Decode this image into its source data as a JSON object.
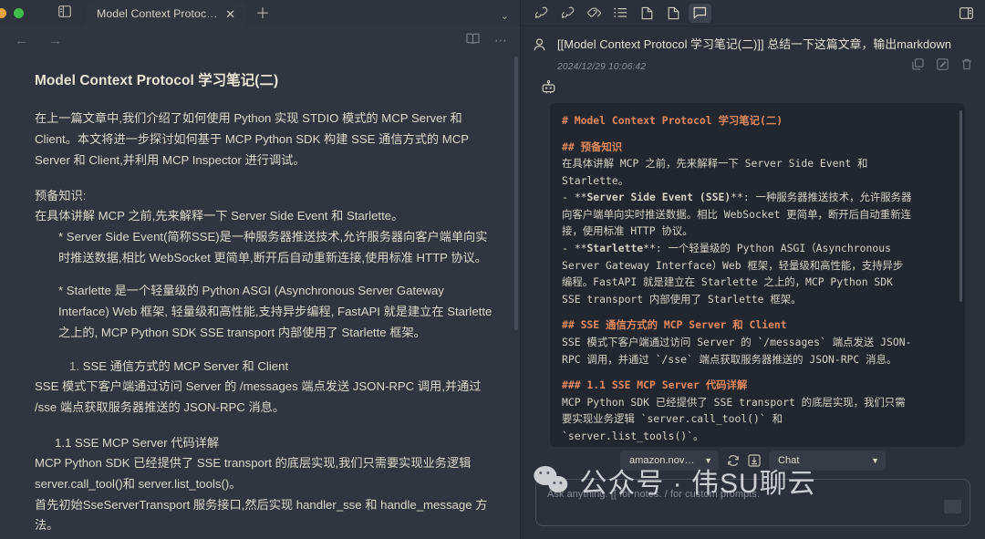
{
  "window": {
    "traffic_lights": [
      "minimize",
      "maximize"
    ],
    "sidebar_toggle_icon": "sidebar-icon",
    "tab": {
      "title": "Model Context Protocol ...",
      "close_icon": "close-icon"
    },
    "new_tab_icon": "plus-icon",
    "tab_overflow_icon": "chevron-down-icon"
  },
  "navbar": {
    "back_icon": "arrow-left-icon",
    "forward_icon": "arrow-right-icon",
    "reader_icon": "book-icon",
    "more_icon": "ellipsis-icon"
  },
  "document": {
    "title": "Model Context Protocol 学习笔记(二)",
    "paragraphs": [
      "在上一篇文章中,我们介绍了如何使用 Python 实现 STDIO 模式的 MCP Server 和 Client。本文将进一步探讨如何基于 MCP Python SDK 构建 SSE 通信方式的 MCP Server 和 Client,并利用 MCP Inspector 进行调试。"
    ],
    "prereq_label": "预备知识:",
    "prereq_intro": "在具体讲解 MCP 之前,先来解释一下 Server Side Event 和 Starlette。",
    "bullets": [
      "* Server Side Event(简称SSE)是一种服务器推送技术,允许服务器向客户端单向实时推送数据,相比 WebSocket 更简单,断开后自动重新连接,使用标准 HTTP 协议。",
      "* Starlette 是一个轻量级的 Python ASGI (Asynchronous Server Gateway Interface) Web 框架, 轻量级和高性能,支持异步编程, FastAPI 就是建立在 Starlette 之上的, MCP Python SDK SSE transport 内部使用了 Starlette 框架。"
    ],
    "section1_num": "1.",
    "section1_title": "SSE 通信方式的 MCP Server 和 Client",
    "section1_body": "SSE 模式下客户端通过访问 Server 的 /messages 端点发送 JSON-RPC 调用,并通过 /sse 端点获取服务器推送的 JSON-RPC 消息。",
    "section11_title": "1.1 SSE MCP Server 代码详解",
    "section11_body1": "MCP Python SDK 已经提供了 SSE transport 的底层实现,我们只需要实现业务逻辑server.call_tool()和 server.list_tools()。",
    "section11_body2": "首先初始SseServerTransport 服务接口,然后实现 handler_sse 和 handle_message 方法。"
  },
  "chat": {
    "toolbar_icons": [
      "link-add-icon",
      "link-add-alt-icon",
      "tags-icon",
      "list-icon",
      "document-icon",
      "document-alt-icon",
      "chat-bubble-icon"
    ],
    "panel_toggle_icon": "panel-right-icon",
    "user_avatar_icon": "user-icon",
    "message_title": "[[Model Context Protocol 学习笔记(二)]] 总结一下这篇文章，输出markdown",
    "timestamp": "2024/12/29 10:06:42",
    "message_actions": [
      "copy-icon",
      "edit-icon",
      "delete-icon"
    ],
    "bot_avatar_icon": "robot-icon",
    "response_lines": [
      {
        "prefix": "# ",
        "text": "Model Context Protocol 学习笔记(二)",
        "style": "heading"
      },
      {
        "prefix": "",
        "text": "",
        "style": "blank"
      },
      {
        "prefix": "## ",
        "text": "预备知识",
        "style": "heading"
      },
      {
        "prefix": "",
        "text": "在具体讲解 MCP 之前，先来解释一下 Server Side Event 和",
        "style": "body"
      },
      {
        "prefix": "",
        "text": "Starlette。",
        "style": "body"
      },
      {
        "prefix": "",
        "text": "- **Server Side Event (SSE)**: 一种服务器推送技术，允许服务器",
        "style": "body-bold-lead"
      },
      {
        "prefix": "",
        "text": "向客户端单向实时推送数据。相比 WebSocket 更简单，断开后自动重新连",
        "style": "body"
      },
      {
        "prefix": "",
        "text": "接，使用标准 HTTP 协议。",
        "style": "body"
      },
      {
        "prefix": "",
        "text": "- **Starlette**: 一个轻量级的 Python ASGI（Asynchronous",
        "style": "body-bold-lead2"
      },
      {
        "prefix": "",
        "text": "Server Gateway Interface）Web 框架，轻量级和高性能，支持异步",
        "style": "body"
      },
      {
        "prefix": "",
        "text": "编程。FastAPI 就是建立在 Starlette 之上的，MCP Python SDK",
        "style": "body"
      },
      {
        "prefix": "",
        "text": "SSE transport 内部使用了 Starlette 框架。",
        "style": "body"
      },
      {
        "prefix": "",
        "text": "",
        "style": "blank"
      },
      {
        "prefix": "## ",
        "text": "SSE 通信方式的 MCP Server 和 Client",
        "style": "heading"
      },
      {
        "prefix": "",
        "text": "SSE 模式下客户端通过访问 Server 的 `/messages` 端点发送 JSON-",
        "style": "body"
      },
      {
        "prefix": "",
        "text": "RPC 调用，并通过 `/sse` 端点获取服务器推送的 JSON-RPC 消息。",
        "style": "body"
      },
      {
        "prefix": "",
        "text": "",
        "style": "blank"
      },
      {
        "prefix": "### ",
        "text": "1.1 SSE MCP Server 代码详解",
        "style": "heading"
      },
      {
        "prefix": "",
        "text": "MCP Python SDK 已经提供了 SSE transport 的底层实现，我们只需",
        "style": "body"
      },
      {
        "prefix": "",
        "text": "要实现业务逻辑 `server.call_tool()` 和",
        "style": "body"
      },
      {
        "prefix": "",
        "text": "`server.list_tools()`。",
        "style": "body"
      }
    ],
    "model_select": {
      "value": "amazon.nova-pr...",
      "caret_icon": "caret-down-icon"
    },
    "refresh_icon": "refresh-icon",
    "save_icon": "save-icon",
    "mode_select": {
      "value": "Chat",
      "caret_icon": "caret-down-icon"
    },
    "composer_placeholder": "Ask anything. [[ for notes. / for custom prompts."
  },
  "watermark": {
    "text": "公众号 · 伟SU聊云",
    "icon": "wechat-icon"
  },
  "colors": {
    "app_bg": "#2b303b",
    "left_bg": "#30353f",
    "code_bg": "#22262e",
    "text": "#ddd8c8",
    "heading_accent": "#e2895e",
    "traffic_yellow": "#e8a33d",
    "traffic_green": "#3fbd4a"
  }
}
